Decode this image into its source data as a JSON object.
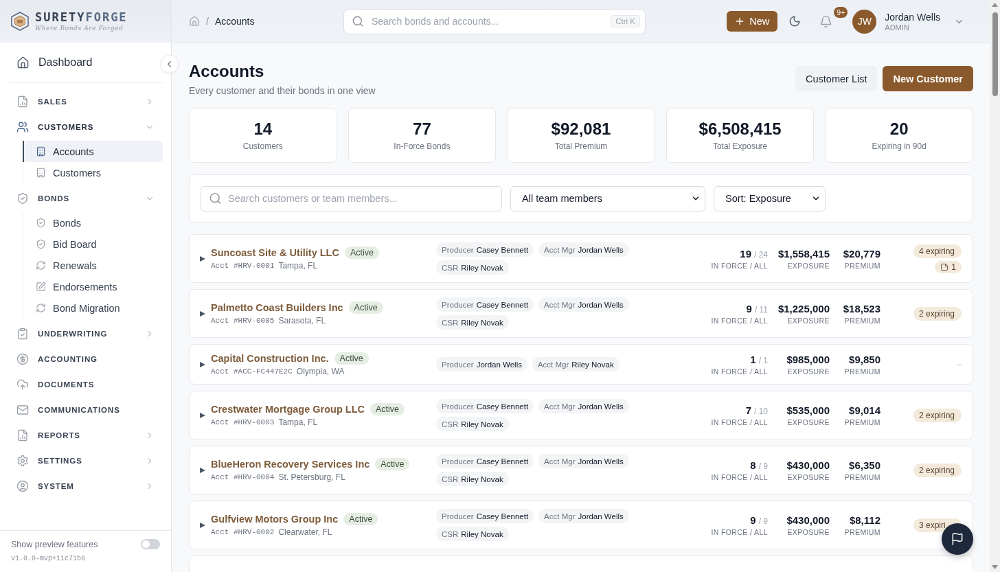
{
  "sidebar": {
    "logo": {
      "word_1": "SURETY",
      "word_2": "FORGE",
      "tagline": "Where Bonds Are Forged"
    },
    "dashboard": {
      "label": "Dashboard",
      "selected": false
    },
    "sections": [
      {
        "label": "SALES",
        "kind": "group",
        "selected": false,
        "expanded": false
      },
      {
        "label": "CUSTOMERS",
        "kind": "group",
        "selected": true,
        "expanded": true,
        "children": [
          {
            "label": "Accounts",
            "selected": true
          },
          {
            "label": "Customers",
            "selected": false
          }
        ]
      },
      {
        "label": "BONDS",
        "kind": "group",
        "selected": false,
        "expanded": true,
        "children": [
          {
            "label": "Bonds",
            "selected": false
          },
          {
            "label": "Bid Board",
            "selected": false
          },
          {
            "label": "Renewals",
            "selected": false
          },
          {
            "label": "Endorsements",
            "selected": false
          },
          {
            "label": "Bond Migration",
            "selected": false
          }
        ]
      },
      {
        "label": "UNDERWRITING",
        "kind": "group",
        "selected": false,
        "expanded": false
      },
      {
        "label": "ACCOUNTING",
        "kind": "link",
        "selected": false
      },
      {
        "label": "DOCUMENTS",
        "kind": "link",
        "selected": false
      },
      {
        "label": "COMMUNICATIONS",
        "kind": "link",
        "selected": false
      },
      {
        "label": "REPORTS",
        "kind": "group",
        "selected": false,
        "expanded": false
      },
      {
        "label": "SETTINGS",
        "kind": "group",
        "selected": false,
        "expanded": false
      },
      {
        "label": "SYSTEM",
        "kind": "group",
        "selected": false,
        "expanded": false
      }
    ],
    "preview": {
      "label": "Show preview features",
      "on": false
    },
    "version": "v1.0.0-mvp+11c71b6"
  },
  "header": {
    "breadcrumb": {
      "separator": "/",
      "current": "Accounts"
    },
    "search": {
      "placeholder": "Search bonds and accounts...",
      "shortcut": "Ctrl K"
    },
    "new_button": "New",
    "notifications": {
      "badge": "9+"
    },
    "user": {
      "initials": "JW",
      "name": "Jordan Wells",
      "role": "ADMIN"
    }
  },
  "page": {
    "title": "Accounts",
    "subtitle": "Every customer and their bonds in one view",
    "buttons": [
      {
        "label": "Customer List",
        "kind": "secondary"
      },
      {
        "label": "New Customer",
        "kind": "primary"
      }
    ]
  },
  "stats": [
    {
      "value": "14",
      "label": "Customers"
    },
    {
      "value": "77",
      "label": "In-Force Bonds"
    },
    {
      "value": "$92,081",
      "label": "Total Premium"
    },
    {
      "value": "$6,508,415",
      "label": "Total Exposure"
    },
    {
      "value": "20",
      "label": "Expiring in 90d"
    }
  ],
  "filters": {
    "search": {
      "placeholder": "Search customers or team members..."
    },
    "team_select": "All team members",
    "sort_select": "Sort: Exposure"
  },
  "accounts": [
    {
      "kind": "full",
      "expanded": false,
      "name": "Suncoast Site & Utility LLC",
      "status": "Active",
      "account_number": "Acct #HRV-0001",
      "location": "Tampa, FL",
      "team": [
        {
          "role": "Producer",
          "name": "Casey Bennett"
        },
        {
          "role": "Acct Mgr",
          "name": "Jordan Wells"
        },
        {
          "role": "CSR",
          "name": "Riley Novak"
        }
      ],
      "bonds": "19",
      "bonds_total": "/ 24",
      "bonds_label": "IN FORCE / ALL",
      "exposure": "$1,558,415",
      "exposure_label": "EXPOSURE",
      "premium": "$20,779",
      "premium_label": "PREMIUM",
      "alert": {
        "kind": "badge",
        "text": "4 expiring"
      },
      "notes": "1"
    },
    {
      "kind": "full",
      "expanded": false,
      "name": "Palmetto Coast Builders Inc",
      "status": "Active",
      "account_number": "Acct #HRV-0005",
      "location": "Sarasota, FL",
      "team": [
        {
          "role": "Producer",
          "name": "Casey Bennett"
        },
        {
          "role": "Acct Mgr",
          "name": "Jordan Wells"
        },
        {
          "role": "CSR",
          "name": "Riley Novak"
        }
      ],
      "bonds": "9",
      "bonds_total": "/ 11",
      "bonds_label": "IN FORCE / ALL",
      "exposure": "$1,225,000",
      "exposure_label": "EXPOSURE",
      "premium": "$18,523",
      "premium_label": "PREMIUM",
      "alert": {
        "kind": "badge",
        "text": "2 expiring"
      }
    },
    {
      "kind": "full",
      "expanded": false,
      "name": "Capital Construction Inc.",
      "status": "Active",
      "account_number": "Acct #ACC-FC447E2C",
      "location": "Olympia, WA",
      "team": [
        {
          "role": "Producer",
          "name": "Jordan Wells"
        },
        {
          "role": "Acct Mgr",
          "name": "Riley Novak"
        }
      ],
      "bonds": "1",
      "bonds_total": "/ 1",
      "bonds_label": "IN FORCE / ALL",
      "exposure": "$985,000",
      "exposure_label": "EXPOSURE",
      "premium": "$9,850",
      "premium_label": "PREMIUM",
      "alert": {
        "kind": "dash",
        "text": "–"
      }
    },
    {
      "kind": "full",
      "expanded": false,
      "name": "Crestwater Mortgage Group LLC",
      "status": "Active",
      "account_number": "Acct #HRV-0003",
      "location": "Tampa, FL",
      "team": [
        {
          "role": "Producer",
          "name": "Casey Bennett"
        },
        {
          "role": "Acct Mgr",
          "name": "Jordan Wells"
        },
        {
          "role": "CSR",
          "name": "Riley Novak"
        }
      ],
      "bonds": "7",
      "bonds_total": "/ 10",
      "bonds_label": "IN FORCE / ALL",
      "exposure": "$535,000",
      "exposure_label": "EXPOSURE",
      "premium": "$9,014",
      "premium_label": "PREMIUM",
      "alert": {
        "kind": "badge",
        "text": "2 expiring"
      }
    },
    {
      "kind": "full",
      "expanded": false,
      "name": "BlueHeron Recovery Services Inc",
      "status": "Active",
      "account_number": "Acct #HRV-0004",
      "location": "St. Petersburg, FL",
      "team": [
        {
          "role": "Producer",
          "name": "Casey Bennett"
        },
        {
          "role": "Acct Mgr",
          "name": "Jordan Wells"
        },
        {
          "role": "CSR",
          "name": "Riley Novak"
        }
      ],
      "bonds": "8",
      "bonds_total": "/ 9",
      "bonds_label": "IN FORCE / ALL",
      "exposure": "$430,000",
      "exposure_label": "EXPOSURE",
      "premium": "$6,350",
      "premium_label": "PREMIUM",
      "alert": {
        "kind": "badge",
        "text": "2 expiring"
      }
    },
    {
      "kind": "full",
      "expanded": false,
      "name": "Gulfview Motors Group Inc",
      "status": "Active",
      "account_number": "Acct #HRV-0002",
      "location": "Clearwater, FL",
      "team": [
        {
          "role": "Producer",
          "name": "Casey Bennett"
        },
        {
          "role": "Acct Mgr",
          "name": "Jordan Wells"
        },
        {
          "role": "CSR",
          "name": "Riley Novak"
        }
      ],
      "bonds": "9",
      "bonds_total": "/ 9",
      "bonds_label": "IN FORCE / ALL",
      "exposure": "$430,000",
      "exposure_label": "EXPOSURE",
      "premium": "$8,112",
      "premium_label": "PREMIUM",
      "alert": {
        "kind": "badge",
        "text": "3 expiri"
      }
    },
    {
      "kind": "partial"
    }
  ]
}
